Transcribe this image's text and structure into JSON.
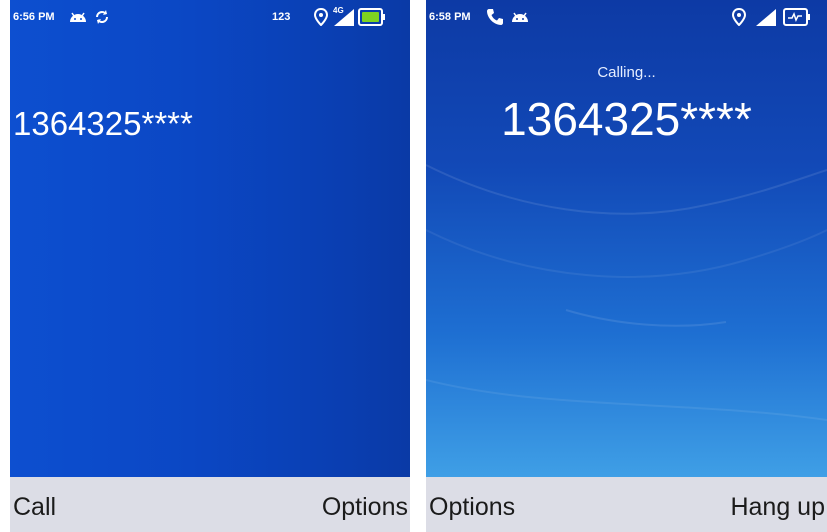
{
  "left_screen": {
    "status_bar": {
      "time": "6:56 PM",
      "left_icons": [
        "android-icon",
        "sync-icon"
      ],
      "input_mode": "123",
      "network": "4G",
      "right_icons": [
        "location-icon",
        "signal-4g-icon",
        "battery-icon"
      ],
      "battery_color": "#7ed321"
    },
    "dialed_number": "1364325****",
    "softkeys": {
      "left": "Call",
      "right": "Options"
    }
  },
  "right_screen": {
    "status_bar": {
      "time": "6:58 PM",
      "left_icons": [
        "phone-icon",
        "android-icon"
      ],
      "right_icons": [
        "location-icon",
        "signal-icon",
        "battery-charging-icon"
      ]
    },
    "call_status": "Calling...",
    "number": "1364325****",
    "softkeys": {
      "left": "Options",
      "right": "Hang up"
    }
  }
}
